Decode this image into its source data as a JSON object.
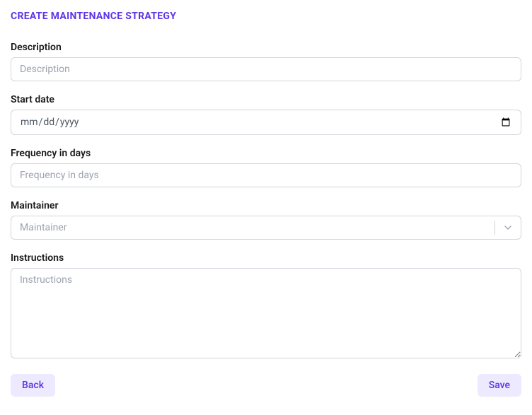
{
  "title": "CREATE MAINTENANCE STRATEGY",
  "fields": {
    "description": {
      "label": "Description",
      "placeholder": "Description",
      "value": ""
    },
    "start_date": {
      "label": "Start date",
      "placeholder": "mm/dd/yyyy",
      "value": ""
    },
    "frequency": {
      "label": "Frequency in days",
      "placeholder": "Frequency in days",
      "value": ""
    },
    "maintainer": {
      "label": "Maintainer",
      "placeholder": "Maintainer",
      "value": ""
    },
    "instructions": {
      "label": "Instructions",
      "placeholder": "Instructions",
      "value": ""
    }
  },
  "buttons": {
    "back": "Back",
    "save": "Save"
  }
}
